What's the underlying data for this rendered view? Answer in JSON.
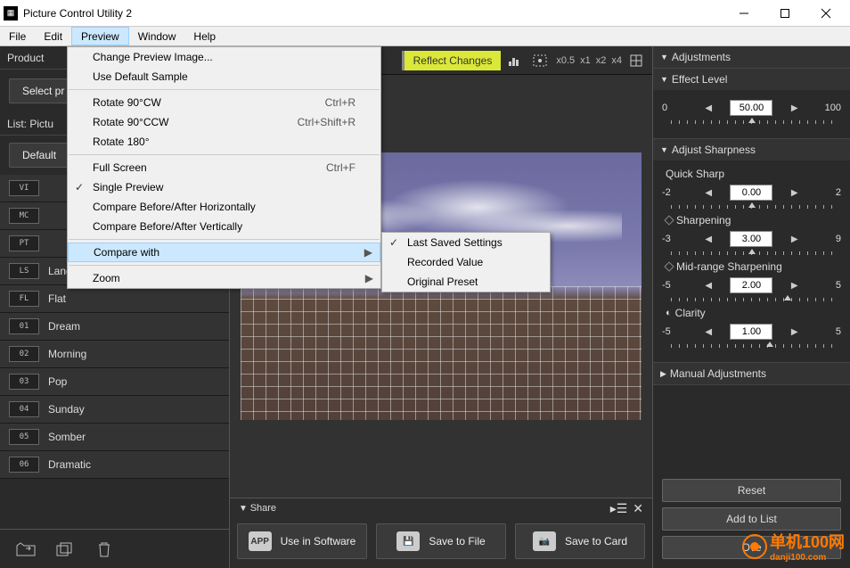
{
  "title": "Picture Control Utility 2",
  "menubar": [
    "File",
    "Edit",
    "Preview",
    "Window",
    "Help"
  ],
  "menubarActiveIndex": 2,
  "previewMenu": {
    "items": [
      {
        "label": "Change Preview Image..."
      },
      {
        "label": "Use Default Sample"
      },
      {
        "sep": true
      },
      {
        "label": "Rotate 90°CW",
        "shortcut": "Ctrl+R"
      },
      {
        "label": "Rotate 90°CCW",
        "shortcut": "Ctrl+Shift+R"
      },
      {
        "label": "Rotate 180°"
      },
      {
        "sep": true
      },
      {
        "label": "Full Screen",
        "shortcut": "Ctrl+F"
      },
      {
        "label": "Single Preview",
        "checked": true
      },
      {
        "label": "Compare Before/After Horizontally"
      },
      {
        "label": "Compare Before/After Vertically"
      },
      {
        "sep": true
      },
      {
        "label": "Compare with",
        "submenu": true,
        "highlighted": true
      },
      {
        "sep": true
      },
      {
        "label": "Zoom",
        "submenu": true
      }
    ],
    "compareSub": [
      {
        "label": "Last Saved Settings",
        "checked": true
      },
      {
        "label": "Recorded Value"
      },
      {
        "label": "Original Preset"
      }
    ]
  },
  "left": {
    "productLabel": "Product",
    "selectButton": "Select pr",
    "listLabel": "List: Pictu",
    "defaultTab": "Default",
    "items": [
      {
        "code": "VI",
        "name": ""
      },
      {
        "code": "MC",
        "name": ""
      },
      {
        "code": "PT",
        "name": ""
      },
      {
        "code": "LS",
        "name": "Landscape"
      },
      {
        "code": "FL",
        "name": "Flat"
      },
      {
        "code": "01",
        "name": "Dream"
      },
      {
        "code": "02",
        "name": "Morning"
      },
      {
        "code": "03",
        "name": "Pop"
      },
      {
        "code": "04",
        "name": "Sunday"
      },
      {
        "code": "05",
        "name": "Somber"
      },
      {
        "code": "06",
        "name": "Dramatic"
      }
    ]
  },
  "toolbar": {
    "reflect": "Reflect Changes",
    "zooms": [
      "x0.5",
      "x1",
      "x2",
      "x4"
    ]
  },
  "share": {
    "label": "Share",
    "useInSoftware": "Use in Software",
    "saveToFile": "Save to File",
    "saveToCard": "Save to Card"
  },
  "right": {
    "adjustments": "Adjustments",
    "effectLevel": {
      "label": "Effect Level",
      "min": "0",
      "max": "100",
      "value": "50.00",
      "pos": 50
    },
    "adjustSharpness": "Adjust Sharpness",
    "quickSharp": {
      "label": "Quick Sharp",
      "min": "-2",
      "max": "2",
      "value": "0.00",
      "pos": 50
    },
    "sharpening": {
      "label": "Sharpening",
      "min": "-3",
      "max": "9",
      "value": "3.00",
      "pos": 50
    },
    "midrange": {
      "label": "Mid-range Sharpening",
      "min": "-5",
      "max": "5",
      "value": "2.00",
      "pos": 70
    },
    "clarity": {
      "label": "Clarity",
      "min": "-5",
      "max": "5",
      "value": "1.00",
      "pos": 60
    },
    "manualAdjust": "Manual Adjustments",
    "reset": "Reset",
    "addToList": "Add to List",
    "overwritePartial": "Ove"
  },
  "watermark": {
    "big": "单机100网",
    "small": "danji100.com"
  }
}
